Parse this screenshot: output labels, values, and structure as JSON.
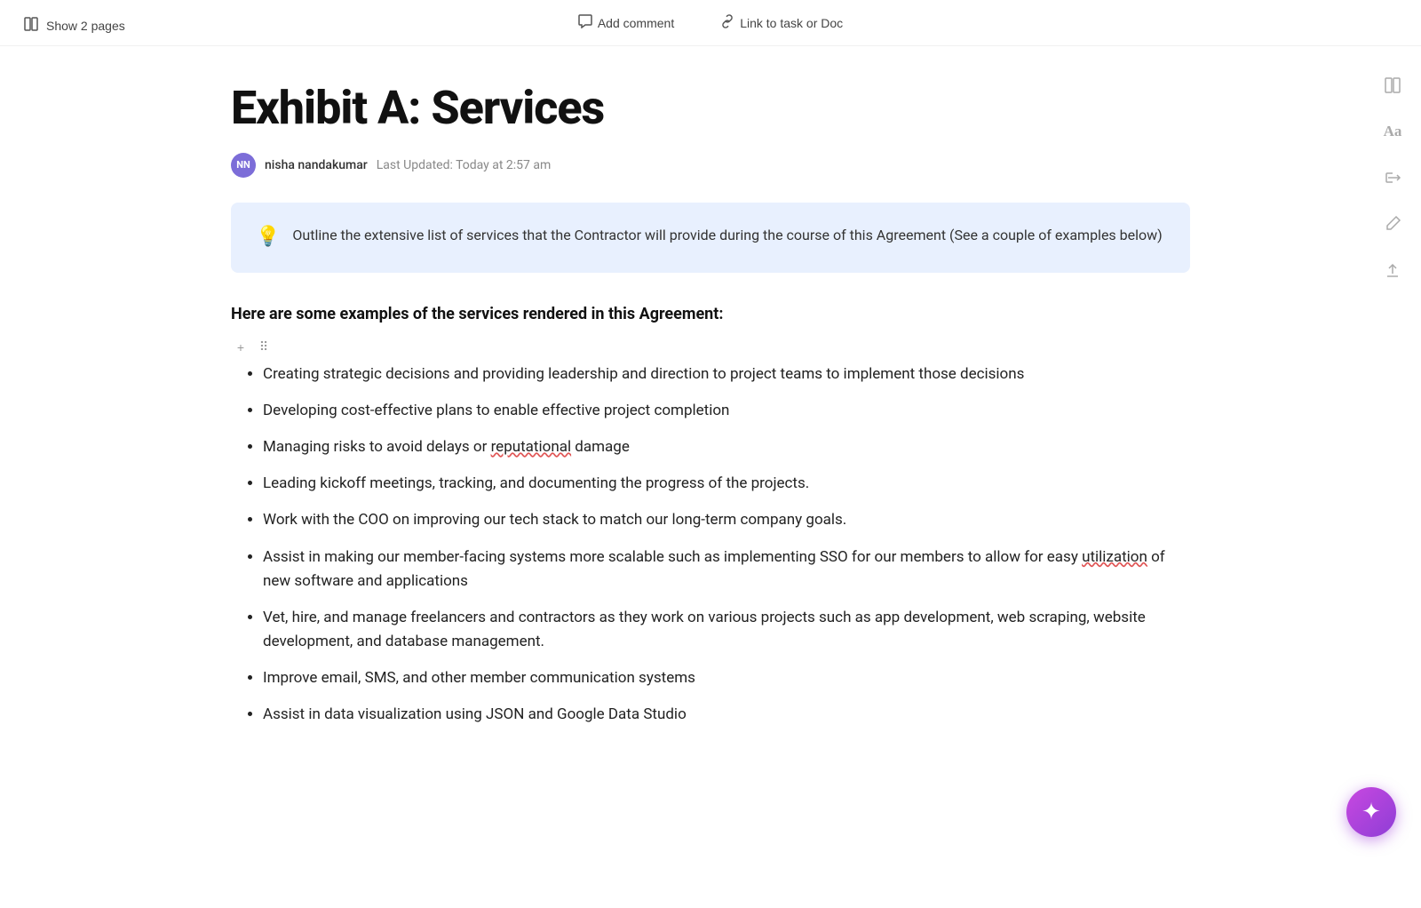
{
  "toolbar": {
    "add_comment_label": "Add comment",
    "link_label": "Link to task or Doc",
    "show_pages_label": "Show 2 pages"
  },
  "document": {
    "title": "Exhibit A: Services",
    "author": {
      "initials": "NN",
      "name": "nisha nandakumar",
      "last_updated": "Last Updated: Today at 2:57 am"
    },
    "callout": {
      "icon": "💡",
      "text": "Outline the extensive list of services that the Contractor will provide during the course of this Agreement (See a couple of examples below)"
    },
    "section_heading": "Here are some examples of the services rendered in this Agreement:",
    "bullet_items": [
      "Creating strategic decisions and providing leadership and direction to project teams to implement those decisions",
      "Developing cost-effective plans to enable effective project completion",
      "Managing risks to avoid delays or reputational damage",
      "Leading kickoff meetings, tracking, and documenting the progress of the projects.",
      "Work with the COO on improving our tech stack to match our long-term company goals.",
      "Assist in making our member-facing systems more scalable such as implementing SSO for our members to allow for easy utilization of new software and applications",
      "Vet, hire, and manage freelancers and contractors as they work on various projects such as app development, web scraping, website development, and database management.",
      "Improve email, SMS, and other member communication systems",
      "Assist in data visualization using JSON and Google Data Studio"
    ]
  },
  "right_sidebar": {
    "icons": [
      "layout",
      "text",
      "share",
      "edit",
      "upload"
    ]
  },
  "fab": {
    "icon": "✦"
  }
}
